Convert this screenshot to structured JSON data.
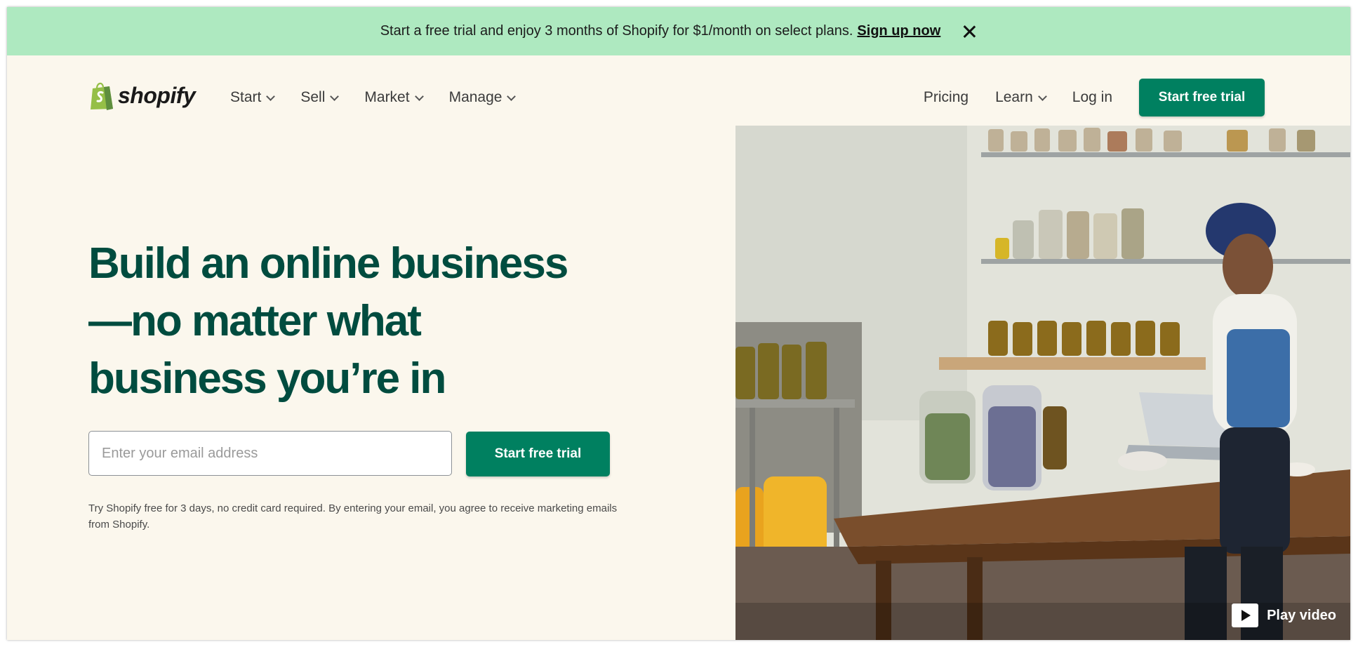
{
  "promo": {
    "text": "Start a free trial and enjoy 3 months of Shopify for $1/month on select plans.",
    "link": "Sign up now",
    "close_icon": "close-icon"
  },
  "nav": {
    "logo_text": "shopify",
    "left_items": [
      {
        "label": "Start"
      },
      {
        "label": "Sell"
      },
      {
        "label": "Market"
      },
      {
        "label": "Manage"
      }
    ],
    "right_items": {
      "pricing": "Pricing",
      "learn": "Learn",
      "login": "Log in"
    },
    "cta": "Start free trial"
  },
  "hero": {
    "title": "Build an online business—no matter what business you’re in",
    "email_placeholder": "Enter your email address",
    "cta": "Start free trial",
    "disclaimer": "Try Shopify free for 3 days, no credit card required. By entering your email, you agree to receive marketing emails from Shopify.",
    "video_label": "Play video"
  },
  "colors": {
    "promo_bg": "#aee9c0",
    "page_bg": "#fbf7ed",
    "brand_green": "#008060",
    "heading_green": "#004c3f"
  }
}
